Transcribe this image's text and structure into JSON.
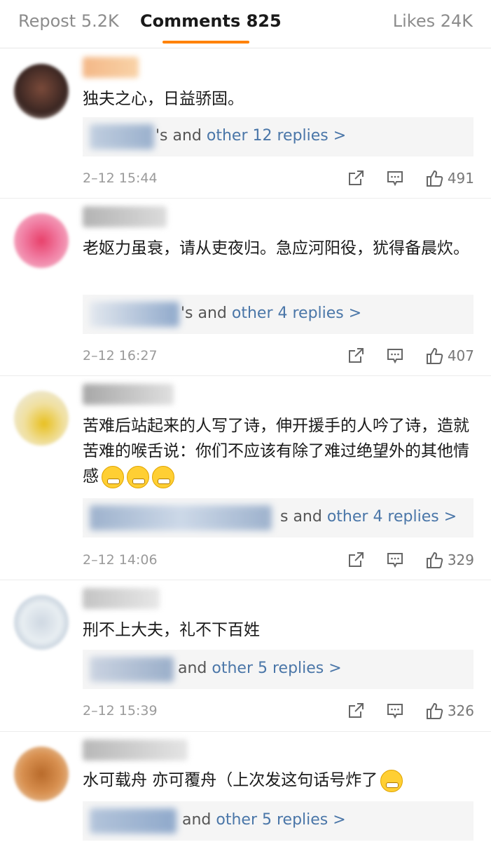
{
  "tabs": {
    "repost": "Repost 5.2K",
    "comments": "Comments 825",
    "likes": "Likes 24K"
  },
  "comments": [
    {
      "text": "独夫之心，日益骄固。",
      "reply_suffix": "'s and ",
      "reply_link": "other 12 replies >",
      "time": "2–12 15:44",
      "likes": "491"
    },
    {
      "text": "老妪力虽衰，请从吏夜归。急应河阳役，犹得备晨炊。",
      "reply_suffix": "'s and ",
      "reply_link": "other 4 replies >",
      "time": "2–12 16:27",
      "likes": "407"
    },
    {
      "text": "苦难后站起来的人写了诗，伸开援手的人吟了诗，造就苦难的喉舌说：你们不应该有除了难过绝望外的其他情感",
      "reply_suffix": "s and ",
      "reply_link": "other 4 replies >",
      "time": "2–12 14:06",
      "likes": "329"
    },
    {
      "text": "刑不上大夫，礼不下百姓",
      "reply_suffix": "and ",
      "reply_link": "other 5 replies >",
      "time": "2–12 15:39",
      "likes": "326"
    },
    {
      "text": "水可载舟 亦可覆舟（上次发这句话号炸了",
      "reply_suffix": "and ",
      "reply_link": "other 5 replies >",
      "time": "",
      "likes": ""
    }
  ],
  "icons": {
    "share": "share-icon",
    "comment": "comment-icon",
    "like": "thumbs-up-icon"
  },
  "colors": {
    "accent": "#ff8200",
    "link": "#4a76a8"
  }
}
